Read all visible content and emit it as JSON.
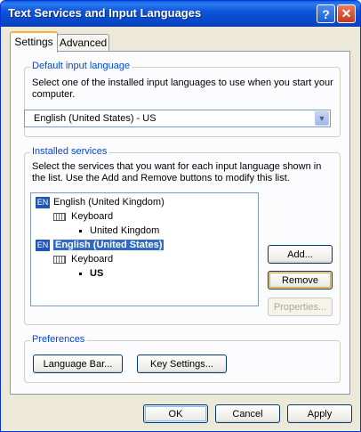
{
  "window": {
    "title": "Text Services and Input Languages"
  },
  "titlebar_buttons": {
    "help": "?",
    "close": "✕"
  },
  "tabs": [
    {
      "label": "Settings",
      "selected": true
    },
    {
      "label": "Advanced",
      "selected": false
    }
  ],
  "default_input_language": {
    "legend": "Default input language",
    "description": "Select one of the installed input languages to use when you start your computer.",
    "selected_value": "English (United States) - US",
    "dropdown_arrow": "▼"
  },
  "installed_services": {
    "legend": "Installed services",
    "description": "Select the services that you want for each input language shown in the list. Use the Add and Remove buttons to modify this list.",
    "tree": [
      {
        "badge": "EN",
        "language": "English (United Kingdom)",
        "service": "Keyboard",
        "layout": "United Kingdom",
        "selected": false
      },
      {
        "badge": "EN",
        "language": "English (United States)",
        "service": "Keyboard",
        "layout": "US",
        "selected": true
      }
    ],
    "buttons": {
      "add": "Add...",
      "remove": "Remove",
      "properties": "Properties..."
    }
  },
  "preferences": {
    "legend": "Preferences",
    "language_bar": "Language Bar...",
    "key_settings": "Key Settings..."
  },
  "footer": {
    "ok": "OK",
    "cancel": "Cancel",
    "apply": "Apply"
  },
  "colors": {
    "titlebar": "#0a5fe6",
    "selection": "#316ac5",
    "legend": "#0046d5",
    "window_bg": "#ece9d8"
  }
}
